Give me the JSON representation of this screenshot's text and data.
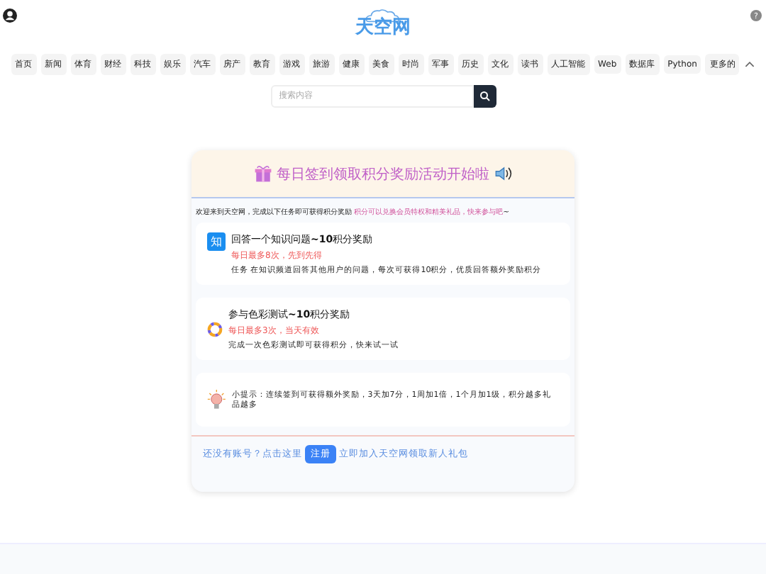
{
  "logo": {
    "text": "天空网"
  },
  "help": {
    "icon_text": "?"
  },
  "nav": {
    "items": [
      "首页",
      "新闻",
      "体育",
      "财经",
      "科技",
      "娱乐",
      "汽车",
      "房产",
      "教育",
      "游戏",
      "旅游",
      "健康",
      "美食",
      "时尚",
      "军事",
      "历史",
      "文化",
      "读书",
      "人工智能",
      "Web",
      "数据库",
      "Python",
      "更多的"
    ],
    "expanded": true
  },
  "search": {
    "placeholder": "搜索内容"
  },
  "card": {
    "title": "每日签到领取积分奖励活动开始啦",
    "intro": "欢迎来到天空网，完成以下任务即可获得积分奖励",
    "intro_highlight": "积分可以兑换会员特权和精美礼品，快来参与吧",
    "intro_tail": "~",
    "tasks": [
      {
        "kind": "zhi",
        "icon_text": "知",
        "title": "回答一个知识问题",
        "title_bold": "~10",
        "title_tail": "积分奖励",
        "note": "每日最多8次，先到先得",
        "desc": "任务 在知识频道回答其他用户的问题，每次可获得10积分，优质回答额外奖励积分"
      },
      {
        "kind": "wheel",
        "title": "参与色彩测试",
        "title_bold": "~10",
        "title_tail": "积分奖励",
        "note": "每日最多3次，当天有效",
        "desc": "完成一次色彩测试即可获得积分，快来试一试"
      },
      {
        "kind": "tip",
        "desc": "小提示：连续签到可获得额外奖励，3天加7分，1周加1倍，1个月加1级，积分越多礼品越多"
      }
    ],
    "footer_before": "还没有账号？点击这里",
    "footer_button": "注册",
    "footer_after": "立即加入天空网领取新人礼包"
  }
}
